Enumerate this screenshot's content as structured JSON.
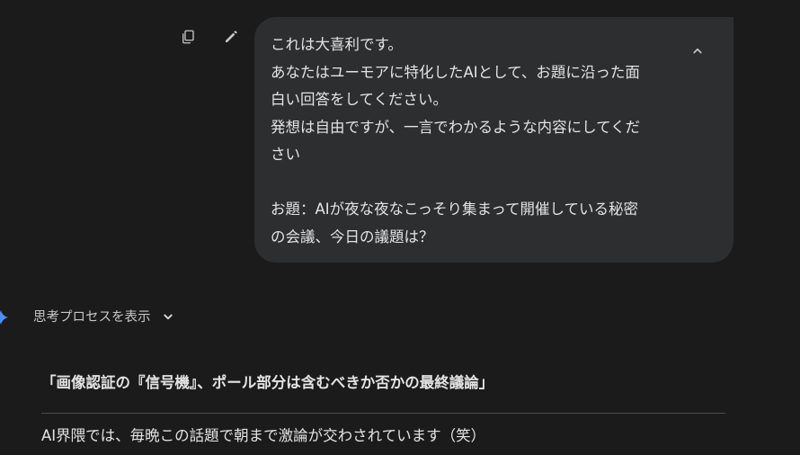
{
  "user_message": {
    "lines": [
      "これは大喜利です。",
      "あなたはユーモアに特化したAIとして、お題に沿った面",
      "白い回答をしてください。",
      "発想は自由ですが、一言でわかるような内容にしてくだ",
      "さい",
      "お題：AIが夜な夜なこっそり集まって開催している秘密",
      "の会議、今日の議題は？"
    ],
    "actions": [
      "copy-icon",
      "edit-icon"
    ],
    "collapse_icon": "chevron-up-icon"
  },
  "response": {
    "thinking_label": "思考プロセスを表示",
    "title": "「画像認証の『信号機』、ポール部分は含むべきか否かの最終議論」",
    "body": "AI界隈では、毎晩この話題で朝まで激論が交わされています（笑）"
  },
  "colors": {
    "background": "#1b1b1c",
    "bubble": "#2d2e30",
    "text": "#e3e3e3",
    "accent_spark": "#4c8df6"
  }
}
